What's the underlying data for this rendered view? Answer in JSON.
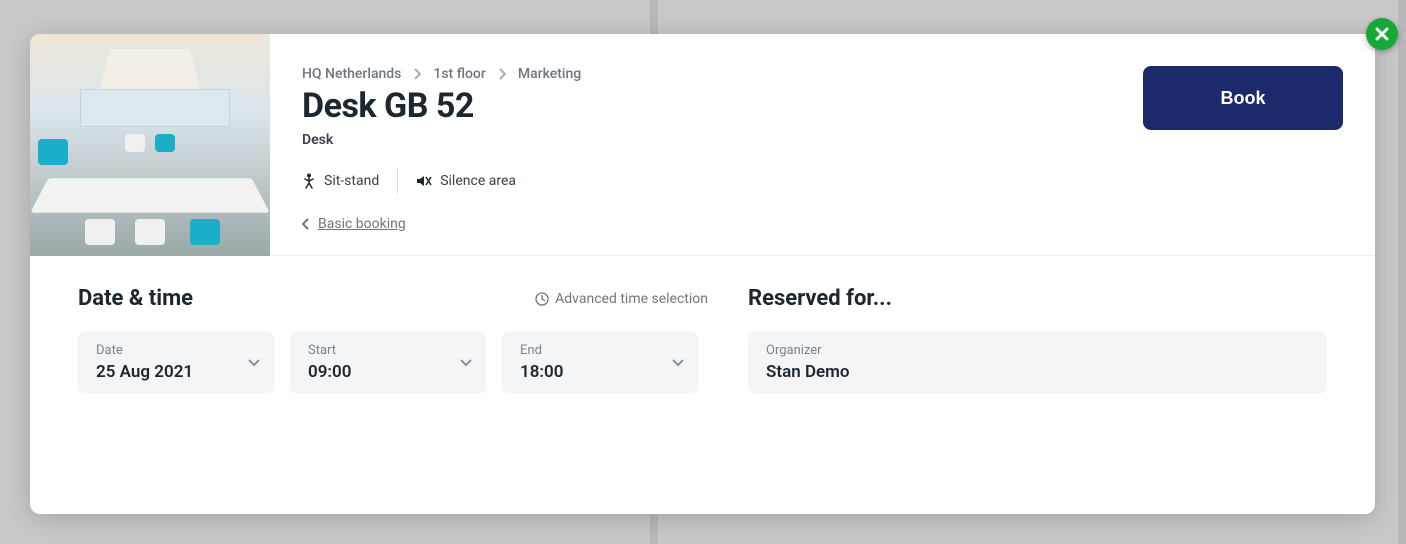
{
  "breadcrumb": {
    "loc": "HQ Netherlands",
    "floor": "1st floor",
    "area": "Marketing"
  },
  "title": "Desk GB 52",
  "subtitle": "Desk",
  "features": {
    "sit_stand": "Sit-stand",
    "silence": "Silence area"
  },
  "back_link": "Basic booking",
  "book_label": "Book",
  "datetime": {
    "section": "Date & time",
    "advanced": "Advanced time selection",
    "date_label": "Date",
    "date_value": "25 Aug 2021",
    "start_label": "Start",
    "start_value": "09:00",
    "end_label": "End",
    "end_value": "18:00"
  },
  "reserved": {
    "section": "Reserved for...",
    "org_label": "Organizer",
    "org_value": "Stan Demo"
  }
}
